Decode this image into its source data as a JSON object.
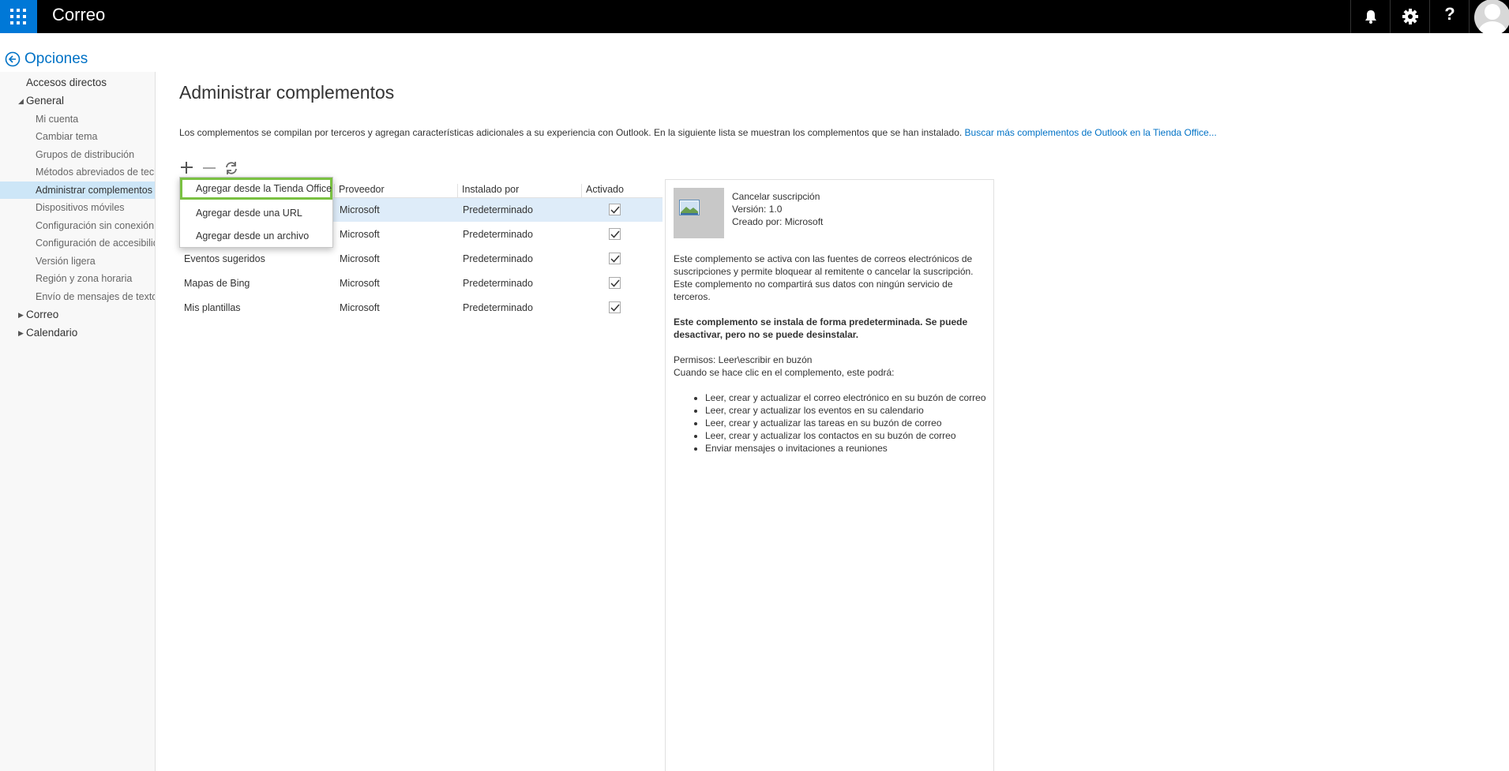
{
  "header": {
    "app_title": "Correo",
    "help_label": "?"
  },
  "options_label": "Opciones",
  "nav": {
    "items": [
      {
        "label": "Accesos directos",
        "level": "top",
        "caret": ""
      },
      {
        "label": "General",
        "level": "top",
        "caret": "◢"
      },
      {
        "label": "Mi cuenta",
        "level": "sub",
        "caret": ""
      },
      {
        "label": "Cambiar tema",
        "level": "sub",
        "caret": ""
      },
      {
        "label": "Grupos de distribución",
        "level": "sub",
        "caret": ""
      },
      {
        "label": "Métodos abreviados de teclado",
        "level": "sub",
        "caret": ""
      },
      {
        "label": "Administrar complementos",
        "level": "sub",
        "caret": "",
        "selected": true
      },
      {
        "label": "Dispositivos móviles",
        "level": "sub",
        "caret": ""
      },
      {
        "label": "Configuración sin conexión",
        "level": "sub",
        "caret": ""
      },
      {
        "label": "Configuración de accesibilidad",
        "level": "sub",
        "caret": ""
      },
      {
        "label": "Versión ligera",
        "level": "sub",
        "caret": ""
      },
      {
        "label": "Región y zona horaria",
        "level": "sub",
        "caret": ""
      },
      {
        "label": "Envío de mensajes de texto",
        "level": "sub",
        "caret": ""
      },
      {
        "label": "Correo",
        "level": "top",
        "caret": "▶"
      },
      {
        "label": "Calendario",
        "level": "top",
        "caret": "▶"
      }
    ]
  },
  "main": {
    "title": "Administrar complementos",
    "intro_text": "Los complementos se compilan por terceros y agregan características adicionales a su experiencia con Outlook. En la siguiente lista se muestran los complementos que se han instalado. ",
    "intro_link": "Buscar más complementos de Outlook en la Tienda Office..."
  },
  "menu": {
    "items": [
      "Agregar desde la Tienda Office",
      "Agregar desde una URL",
      "Agregar desde un archivo"
    ]
  },
  "table": {
    "columns": [
      "Proveedor",
      "Instalado por",
      "Activado"
    ],
    "rows": [
      {
        "name": "",
        "provider": "Microsoft",
        "installed_by": "Predeterminado",
        "enabled": true,
        "selected": true
      },
      {
        "name": "",
        "provider": "Microsoft",
        "installed_by": "Predeterminado",
        "enabled": true
      },
      {
        "name": "Eventos sugeridos",
        "provider": "Microsoft",
        "installed_by": "Predeterminado",
        "enabled": true
      },
      {
        "name": "Mapas de Bing",
        "provider": "Microsoft",
        "installed_by": "Predeterminado",
        "enabled": true
      },
      {
        "name": "Mis plantillas",
        "provider": "Microsoft",
        "installed_by": "Predeterminado",
        "enabled": true
      }
    ]
  },
  "detail": {
    "name": "Cancelar suscripción",
    "version": "Versión: 1.0",
    "created_by": "Creado por: Microsoft",
    "description": "Este complemento se activa con las fuentes de correos electrónicos de suscripciones y permite bloquear al remitente o cancelar la suscripción. Este complemento no compartirá sus datos con ningún servicio de terceros.",
    "default_note": "Este complemento se instala de forma predeterminada. Se puede desactivar, pero no se puede desinstalar.",
    "permissions": "Permisos: Leer\\escribir en buzón",
    "when_clicked": "Cuando se hace clic en el complemento, este podrá:",
    "capabilities": [
      "Leer, crear y actualizar el correo electrónico en su buzón de correo",
      "Leer, crear y actualizar los eventos en su calendario",
      "Leer, crear y actualizar las tareas en su buzón de correo",
      "Leer, crear y actualizar los contactos en su buzón de correo",
      "Enviar mensajes o invitaciones a reuniones"
    ]
  },
  "colors": {
    "accent": "#0078d7",
    "link": "#0072c6",
    "highlight_border": "#7ac142",
    "selected_row": "#deecf9"
  }
}
